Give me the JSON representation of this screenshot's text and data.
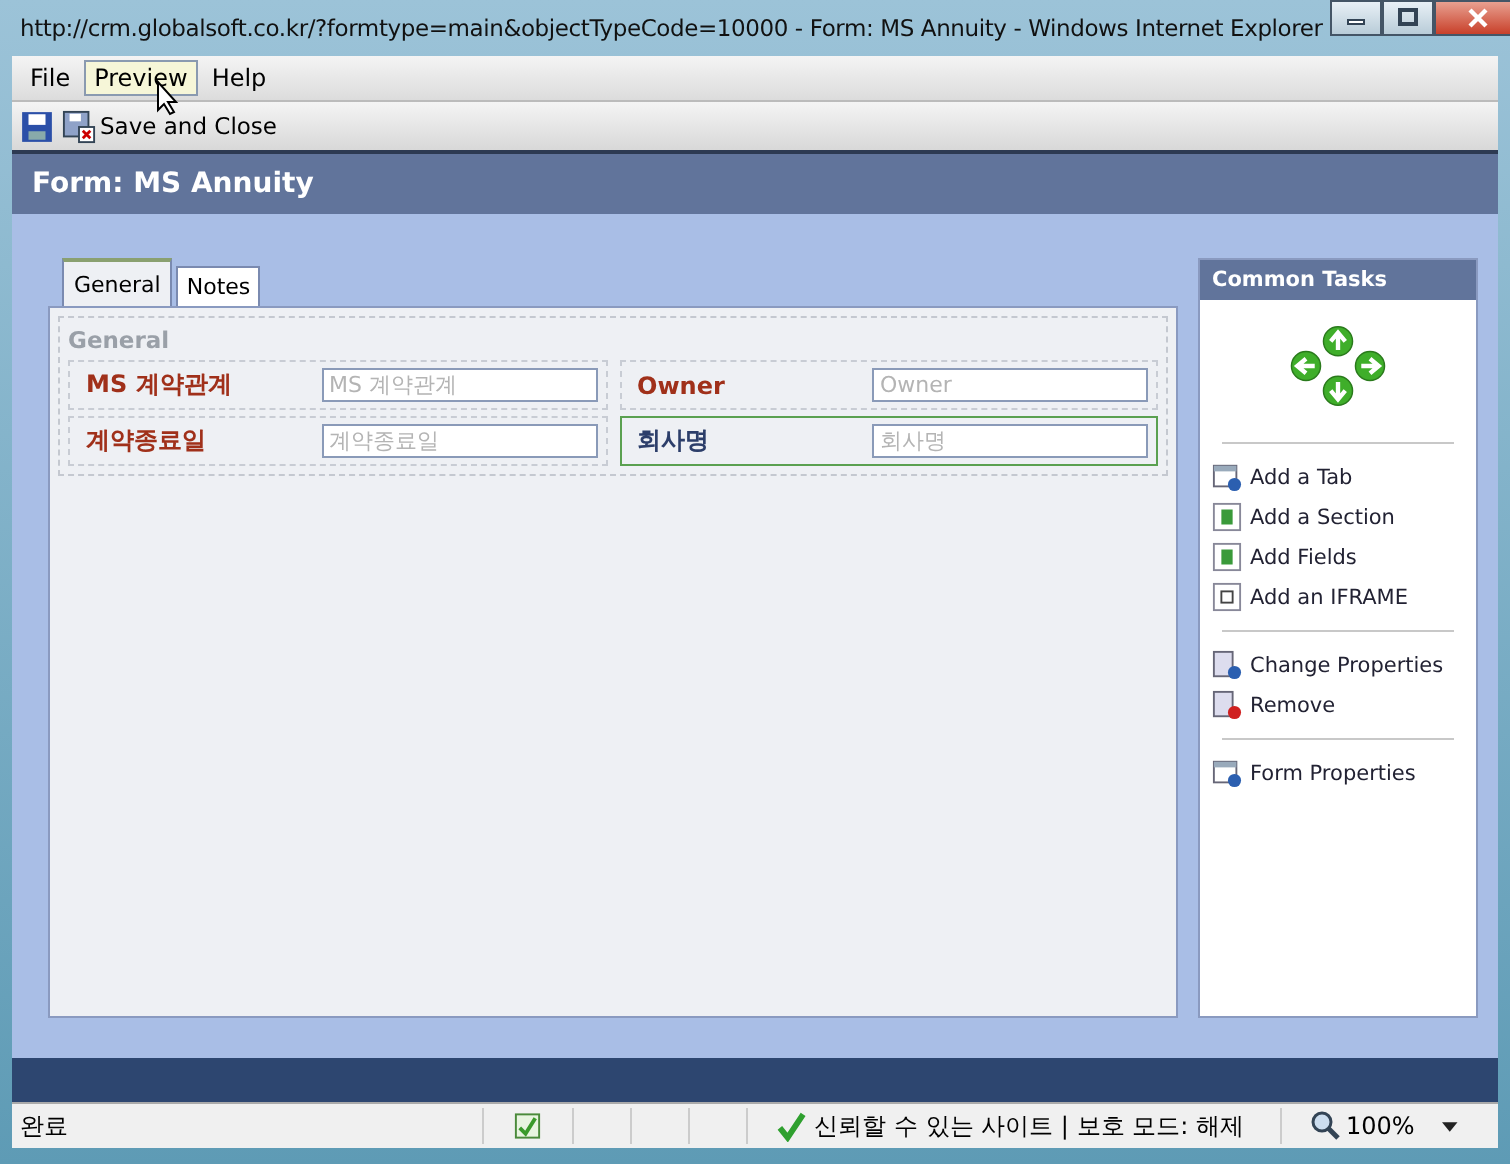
{
  "window": {
    "title": "http://crm.globalsoft.co.kr/?formtype=main&objectTypeCode=10000 - Form: MS Annuity - Windows Internet Explorer"
  },
  "menu": [
    {
      "label": "File",
      "selected": false
    },
    {
      "label": "Preview",
      "selected": true
    },
    {
      "label": "Help",
      "selected": false
    }
  ],
  "toolbar": {
    "save_and_close": "Save and Close"
  },
  "header": {
    "title": "Form: MS Annuity"
  },
  "tabs": [
    {
      "label": "General",
      "selected": true
    },
    {
      "label": "Notes",
      "selected": false
    }
  ],
  "section": {
    "title": "General",
    "rows": [
      [
        {
          "label": "MS 계약관계",
          "placeholder": "MS 계약관계",
          "selected": false
        },
        {
          "label": "Owner",
          "placeholder": "Owner",
          "selected": false
        }
      ],
      [
        {
          "label": "계약종료일",
          "placeholder": "계약종료일",
          "selected": false
        },
        {
          "label": "회사명",
          "placeholder": "회사명",
          "selected": true
        }
      ]
    ]
  },
  "common_tasks": {
    "title": "Common Tasks",
    "groups": [
      [
        {
          "label": "Add a Tab",
          "kind": "tab"
        },
        {
          "label": "Add a Section",
          "kind": "section"
        },
        {
          "label": "Add Fields",
          "kind": "section"
        },
        {
          "label": "Add an IFRAME",
          "kind": "iframe"
        }
      ],
      [
        {
          "label": "Change Properties",
          "kind": "properties"
        },
        {
          "label": "Remove",
          "kind": "remove"
        }
      ],
      [
        {
          "label": "Form Properties",
          "kind": "tab"
        }
      ]
    ]
  },
  "status_bar": {
    "status": "완료",
    "security": "신뢰할 수 있는 사이트 | 보호 모드: 해제",
    "zoom": "100%"
  }
}
